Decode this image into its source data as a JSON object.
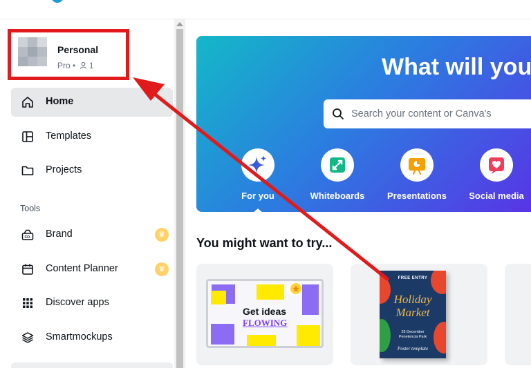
{
  "account": {
    "name": "Personal",
    "plan": "Pro",
    "separator": "•",
    "members_icon": "person-icon",
    "members_count": "1"
  },
  "sidebar": {
    "items": [
      {
        "label": "Home",
        "icon": "home-icon",
        "active": true
      },
      {
        "label": "Templates",
        "icon": "templates-icon",
        "active": false
      },
      {
        "label": "Projects",
        "icon": "folder-icon",
        "active": false
      }
    ],
    "tools_label": "Tools",
    "tools": [
      {
        "label": "Brand",
        "icon": "brand-icon",
        "premium": true
      },
      {
        "label": "Content Planner",
        "icon": "calendar-icon",
        "premium": true
      },
      {
        "label": "Discover apps",
        "icon": "apps-grid-icon",
        "premium": false
      },
      {
        "label": "Smartmockups",
        "icon": "layers-icon",
        "premium": false
      }
    ],
    "premium_icon": "crown-icon"
  },
  "hero": {
    "title": "What will you",
    "search_placeholder": "Search your content or Canva's",
    "categories": [
      {
        "label": "For you",
        "icon": "sparkle-icon",
        "selected": true
      },
      {
        "label": "Whiteboards",
        "icon": "whiteboard-icon",
        "selected": false
      },
      {
        "label": "Presentations",
        "icon": "presentation-icon",
        "selected": false
      },
      {
        "label": "Social media",
        "icon": "heart-icon",
        "selected": false
      }
    ]
  },
  "suggestions": {
    "title": "You might want to try...",
    "cards": [
      {
        "name": "whiteboard",
        "line1": "Get ideas",
        "line2": "FLOWING"
      },
      {
        "name": "poster",
        "top": "FREE ENTRY",
        "title": "Holiday Market",
        "date_line1": "25 December",
        "date_line2": "Penetencia Park",
        "footer": "Poster template"
      }
    ]
  },
  "colors": {
    "annotation_red": "#e11b1b",
    "accent_purple": "#7d3cff",
    "hero_gradient_start": "#14b8c8",
    "hero_gradient_end": "#5a32e6"
  }
}
